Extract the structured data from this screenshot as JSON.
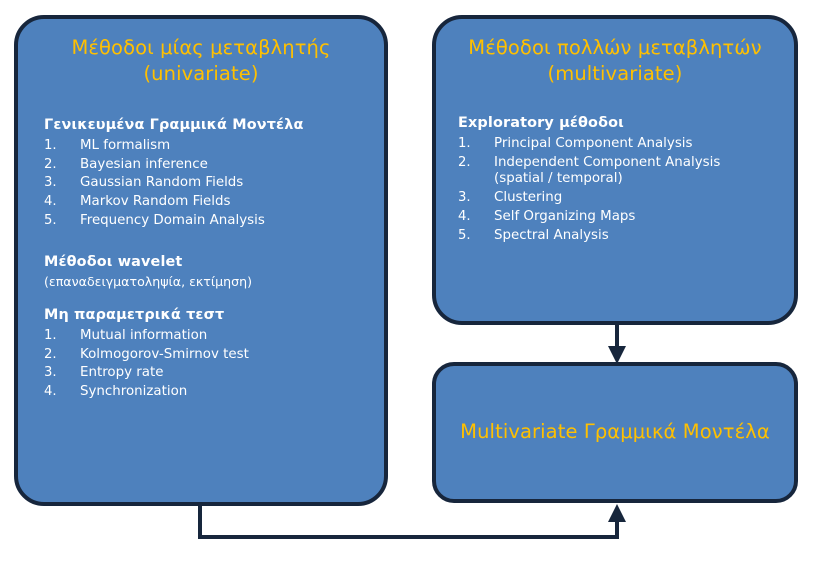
{
  "diagram": {
    "title": "Methods taxonomy flowchart",
    "colors": {
      "box_fill": "#4E81BD",
      "box_border": "#17263C",
      "title_text": "#FFC000",
      "body_text": "#FFFFFF",
      "connector": "#17263C",
      "background": "#FFFFFF"
    }
  },
  "univariate": {
    "title_line1": "Μέθοδοι μίας μεταβλητής",
    "title_line2": "(univariate)",
    "sections": [
      {
        "heading": "Γενικευμένα Γραμμικά  Μοντέλα",
        "items": [
          {
            "num": "1.",
            "text": "ML formalism"
          },
          {
            "num": "2.",
            "text": "Bayesian inference"
          },
          {
            "num": "3.",
            "text": "Gaussian Random Fields"
          },
          {
            "num": "4.",
            "text": "Markov Random Fields"
          },
          {
            "num": "5.",
            "text": "Frequency Domain Analysis"
          }
        ]
      },
      {
        "heading": "Μέθοδοι wavelet",
        "note": "(επαναδειγματοληψία, εκτίμηση)",
        "items": []
      },
      {
        "heading": "Μη παραμετρικά  τεστ",
        "items": [
          {
            "num": "1.",
            "text": "Mutual information"
          },
          {
            "num": "2.",
            "text": "Kolmogorov-Smirnov test"
          },
          {
            "num": "3.",
            "text": "Entropy rate"
          },
          {
            "num": "4.",
            "text": "Synchronization"
          }
        ]
      }
    ]
  },
  "multivariate": {
    "title_line1": "Μέθοδοι πολλών μεταβλητών",
    "title_line2": "(multivariate)",
    "sections": [
      {
        "heading": "Exploratory μέθοδοι",
        "items": [
          {
            "num": "1.",
            "text": "Principal Component Analysis"
          },
          {
            "num": "2.",
            "text": "Independent Component Analysis",
            "continuation": "(spatial / temporal)"
          },
          {
            "num": "3.",
            "text": "Clustering"
          },
          {
            "num": "4.",
            "text": "Self Organizing Maps"
          },
          {
            "num": "5.",
            "text": "Spectral Analysis"
          }
        ]
      }
    ]
  },
  "multivariate_linear_models": {
    "title": "Multivariate Γραμμικά Μοντέλα"
  },
  "connectors": [
    {
      "name": "multivariate-to-mlm",
      "from": "multivariate",
      "to": "multivariate_linear_models",
      "direction": "down"
    },
    {
      "name": "univariate-to-mlm",
      "from": "univariate",
      "to": "multivariate_linear_models",
      "direction": "up"
    }
  ]
}
